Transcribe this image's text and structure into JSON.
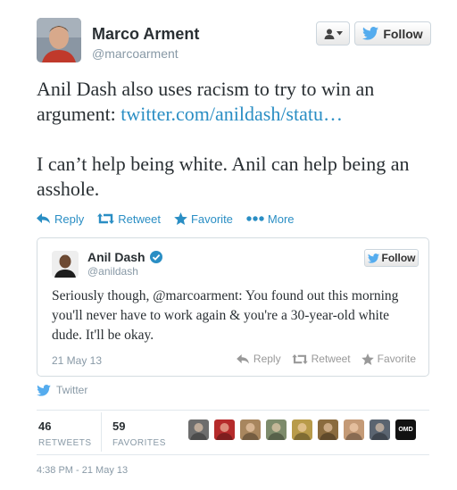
{
  "tweet": {
    "author_name": "Marco Arment",
    "author_handle": "@marcoarment",
    "follow_label": "Follow",
    "text_part1": "Anil Dash also uses racism to try to win an argument: ",
    "link_text": "twitter.com/anildash/statu…",
    "text_part2": "I can’t help being white. Anil can help being an asshole.",
    "actions": {
      "reply": "Reply",
      "retweet": "Retweet",
      "favorite": "Favorite",
      "more": "More"
    }
  },
  "quoted": {
    "author_name": "Anil Dash",
    "author_handle": "@anildash",
    "follow_label": "Follow",
    "text": "Seriously though, @marcoarment: You found out this morning you'll never have to work again & you're a 30-year-old white dude. It'll be okay.",
    "date": "21 May 13",
    "actions": {
      "reply": "Reply",
      "retweet": "Retweet",
      "favorite": "Favorite"
    }
  },
  "via": "Twitter",
  "stats": {
    "retweets_count": "46",
    "retweets_label": "RETWEETS",
    "favorites_count": "59",
    "favorites_label": "FAVORITES"
  },
  "faces": [
    {
      "name": "face-1",
      "color": "#6d6d6d"
    },
    {
      "name": "face-2",
      "color": "#b52b2b"
    },
    {
      "name": "face-3",
      "color": "#a8865e"
    },
    {
      "name": "face-4",
      "color": "#7d8b6b"
    },
    {
      "name": "face-5",
      "color": "#b89b4a"
    },
    {
      "name": "face-6",
      "color": "#8a6b3e"
    },
    {
      "name": "face-7",
      "color": "#c49a76"
    },
    {
      "name": "face-8",
      "color": "#5a6470"
    },
    {
      "name": "face-9",
      "color": "#111111",
      "text": "OMD"
    }
  ],
  "timestamp": "4:38 PM - 21 May 13",
  "colors": {
    "link": "#2a8ec4",
    "twitter_blue": "#55acee",
    "muted": "#8899a6"
  }
}
